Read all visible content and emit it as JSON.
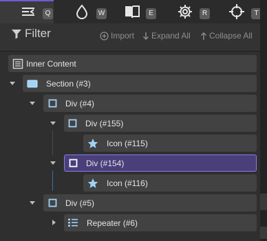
{
  "tabs": [
    {
      "key": "Q",
      "icon": "navigator-icon",
      "active": true
    },
    {
      "key": "W",
      "icon": "drop-icon",
      "active": false
    },
    {
      "key": "E",
      "icon": "book-icon",
      "active": false
    },
    {
      "key": "R",
      "icon": "gear-icon",
      "active": false
    },
    {
      "key": "T",
      "icon": "crosshair-icon",
      "active": false
    }
  ],
  "header": {
    "title": "Filter",
    "import_label": "Import",
    "expand_label": "Expand All",
    "collapse_label": "Collapse All"
  },
  "tree": [
    {
      "label": "Inner Content",
      "icon": "page-icon"
    },
    {
      "label": "Section (#3)",
      "icon": "section-icon",
      "expanded": true
    },
    {
      "label": "Div (#4)",
      "icon": "div-icon",
      "expanded": true
    },
    {
      "label": "Div (#155)",
      "icon": "div-icon",
      "expanded": true
    },
    {
      "label": "Icon (#115)",
      "icon": "star-icon"
    },
    {
      "label": "Div (#154)",
      "icon": "div-icon",
      "expanded": true,
      "selected": true
    },
    {
      "label": "Icon (#116)",
      "icon": "star-icon"
    },
    {
      "label": "Div (#5)",
      "icon": "div-icon",
      "expanded": true
    },
    {
      "label": "Repeater (#6)",
      "icon": "repeater-icon",
      "expanded": false
    }
  ],
  "colors": {
    "accent": "#6f5bd6",
    "selected_bg": "#4a3f7a",
    "icon_blue": "#9fd3f7"
  }
}
